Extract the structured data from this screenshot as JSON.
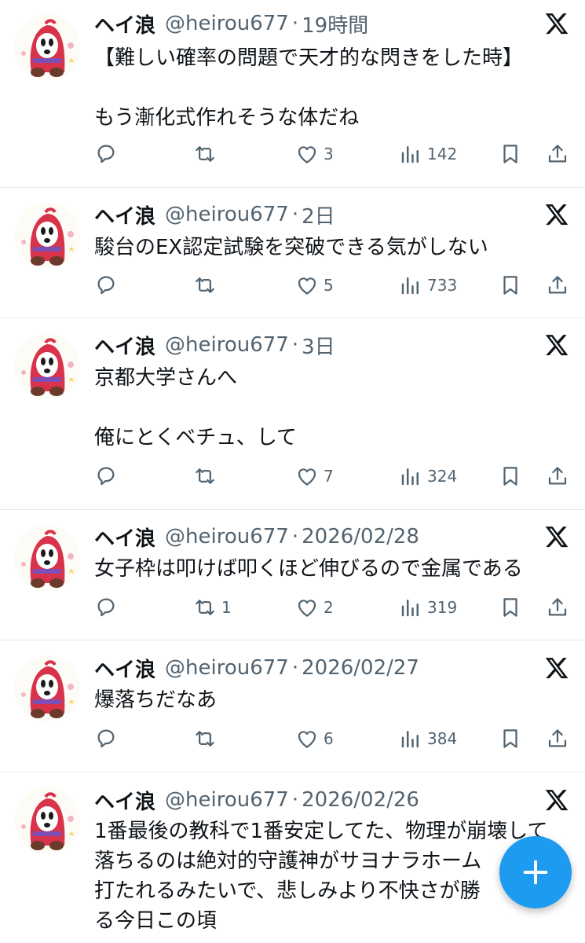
{
  "tweets": [
    {
      "name": "ヘイ浪",
      "handle": "@heirou677",
      "time": "19時間",
      "text": "【難しい確率の問題で天才的な閃きをした時】\n\nもう漸化式作れそうな体だね",
      "replies": "",
      "retweets": "",
      "likes": "3",
      "views": "142"
    },
    {
      "name": "ヘイ浪",
      "handle": "@heirou677",
      "time": "2日",
      "text": "駿台のEX認定試験を突破できる気がしない",
      "replies": "",
      "retweets": "",
      "likes": "5",
      "views": "733"
    },
    {
      "name": "ヘイ浪",
      "handle": "@heirou677",
      "time": "3日",
      "text": "京都大学さんへ\n\n俺にとくベチュ、して",
      "replies": "",
      "retweets": "",
      "likes": "7",
      "views": "324"
    },
    {
      "name": "ヘイ浪",
      "handle": "@heirou677",
      "time": "2026/02/28",
      "text": "女子枠は叩けば叩くほど伸びるので金属である",
      "replies": "",
      "retweets": "1",
      "likes": "2",
      "views": "319"
    },
    {
      "name": "ヘイ浪",
      "handle": "@heirou677",
      "time": "2026/02/27",
      "text": "爆落ちだなあ",
      "replies": "",
      "retweets": "",
      "likes": "6",
      "views": "384"
    },
    {
      "name": "ヘイ浪",
      "handle": "@heirou677",
      "time": "2026/02/26",
      "text": "1番最後の教科で1番安定してた、物理が崩壊して\n落ちるのは絶対的守護神がサヨナラホーム\n打たれるみたいで、悲しみより不快さが勝\nる今日この頃",
      "replies": "",
      "retweets": "",
      "likes": "",
      "views": ""
    }
  ],
  "separator": "·",
  "colors": {
    "text": "#0f1419",
    "secondary": "#536471",
    "accent": "#1d9bf0",
    "divider": "#e6e9ec"
  },
  "icons": {
    "reply": "reply-icon",
    "retweet": "retweet-icon",
    "like": "heart-icon",
    "views": "views-icon",
    "bookmark": "bookmark-icon",
    "share": "share-icon",
    "x": "x-logo-icon",
    "compose": "plus-icon"
  }
}
